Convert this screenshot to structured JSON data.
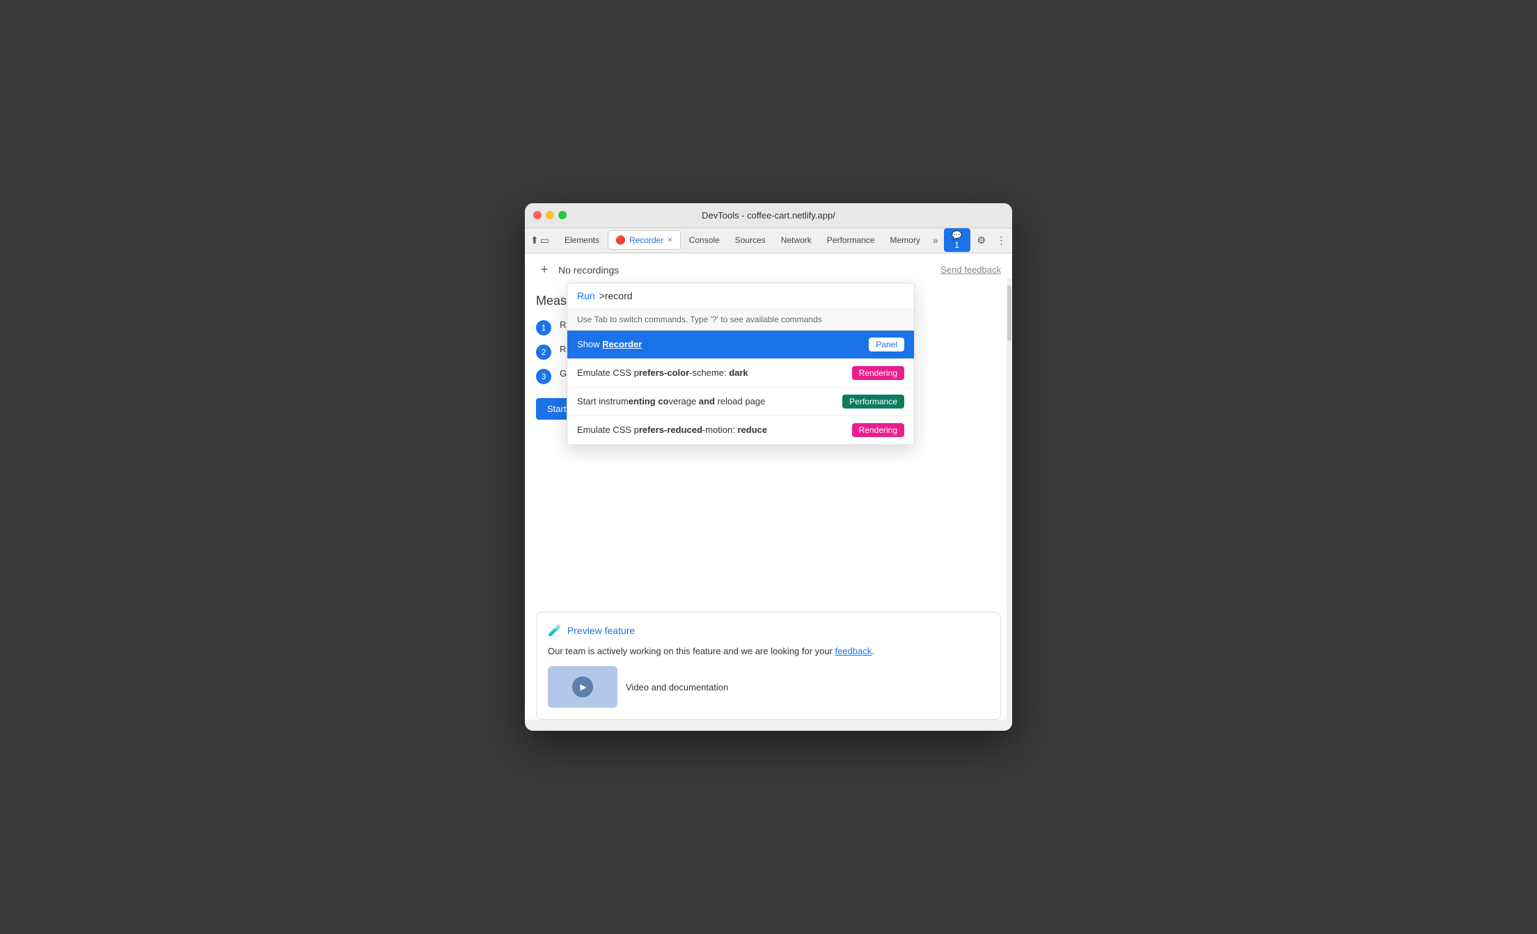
{
  "window": {
    "title": "DevTools - coffee-cart.netlify.app/"
  },
  "tabs": {
    "items": [
      {
        "label": "Elements",
        "active": false
      },
      {
        "label": "Recorder",
        "active": true,
        "icon": "🔴",
        "closable": true
      },
      {
        "label": "Console",
        "active": false
      },
      {
        "label": "Sources",
        "active": false
      },
      {
        "label": "Network",
        "active": false
      },
      {
        "label": "Performance",
        "active": false
      },
      {
        "label": "Memory",
        "active": false
      }
    ],
    "more_label": "»",
    "chat_label": "💬 1",
    "settings_label": "⚙",
    "kebab_label": "⋮"
  },
  "recorder": {
    "add_label": "+",
    "no_recordings": "No recordings",
    "send_feedback": "Send feedback"
  },
  "measure": {
    "title": "Measure perfo",
    "steps": [
      {
        "num": "1",
        "text": "Record a comr"
      },
      {
        "num": "2",
        "text": "Replay the rec"
      },
      {
        "num": "3",
        "text": "Generate a det"
      }
    ],
    "start_button": "Start new recording"
  },
  "command_palette": {
    "run_label": "Run",
    "input_text": ">record",
    "hint": "Use Tab to switch commands. Type '?' to see available commands",
    "items": [
      {
        "text_before": "Show ",
        "text_highlight": "Recorder",
        "text_after": "",
        "badge_label": "Panel",
        "badge_class": "badge-panel",
        "highlighted": true
      },
      {
        "text_before": "Emulate CSS p",
        "text_highlight": "refers-color",
        "text_after": "-scheme: dark",
        "badge_label": "Rendering",
        "badge_class": "badge-rendering",
        "highlighted": false
      },
      {
        "text_before": "Start instrum",
        "text_highlight": "enting co",
        "text_after": "verage and reload page",
        "badge_label": "Performance",
        "badge_class": "badge-performance",
        "highlighted": false
      },
      {
        "text_before": "Emulate CSS p",
        "text_highlight": "refers-reduced",
        "text_after": "-motion: reduce",
        "badge_label": "Rendering",
        "badge_class": "badge-rendering",
        "highlighted": false
      }
    ]
  },
  "preview": {
    "icon": "🧪",
    "title": "Preview feature",
    "text_before": "Our team is actively working on this feature and we are looking for your ",
    "link_text": "feedback",
    "text_after": ".",
    "video_label": "Video and documentation"
  }
}
